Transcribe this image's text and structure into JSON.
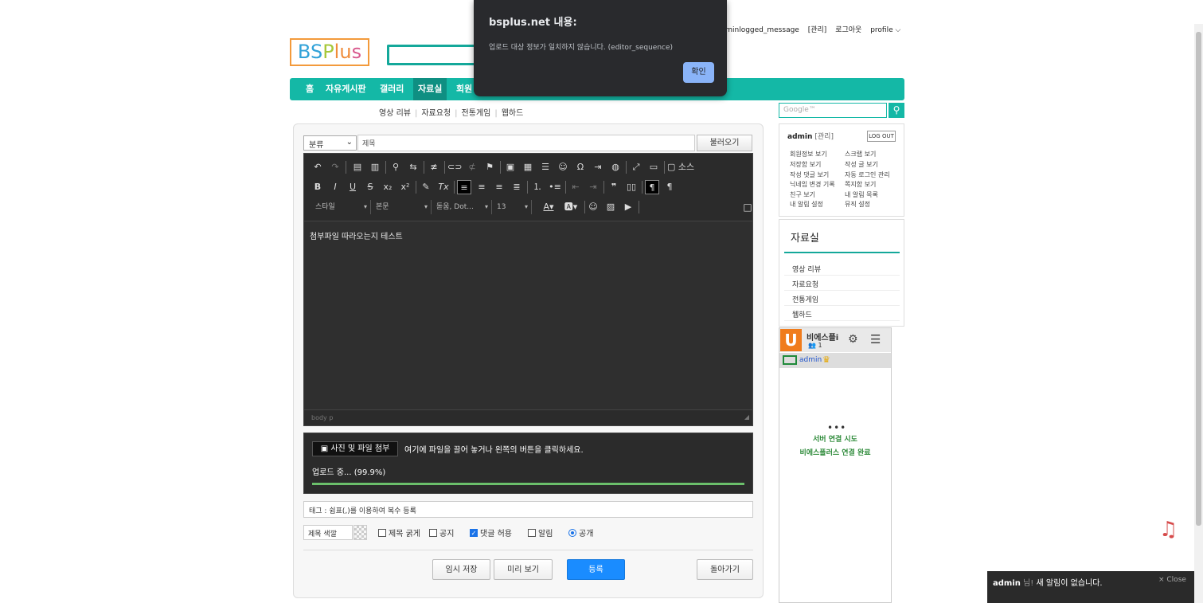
{
  "top_links": {
    "message": "adminlogged_message",
    "manage": "[관리]",
    "logout": "로그아웃",
    "profile": "profile ⌵"
  },
  "logo": {
    "part1": "BS",
    "part2": "P",
    "part3": "lu",
    "part4": "s"
  },
  "nav": {
    "items": [
      "홈",
      "자유게시판",
      "갤러리",
      "자료실",
      "회원"
    ]
  },
  "subnav": {
    "items": [
      "영상 리뷰",
      "자료요청",
      "전통게임",
      "웹하드"
    ]
  },
  "google_placeholder": "Google™",
  "editor_form": {
    "category": "분류",
    "title_placeholder": "제목",
    "load_button": "불러오기",
    "toolbar": {
      "source": "소스",
      "style": "스타일",
      "format": "본문",
      "font": "돋움, Dot...",
      "size": "13"
    },
    "content": "첨부파일 따라오는지 테스트",
    "path": "body  p"
  },
  "upload": {
    "button": "사진 및 파일 첨부",
    "hint": "여기에 파일을 끌어 놓거나 왼쪽의 버튼을 클릭하세요.",
    "status": "업로드 중... (99.9%)",
    "progress": 0.999
  },
  "tags_placeholder": "태그 : 쉼표(,)를 이용하여 복수 등록",
  "options": {
    "title_color": "제목 색깔",
    "bold_title": "제목 굵게",
    "notice": "공지",
    "allow_comments": "댓글 허용",
    "notify": "알림",
    "public": "공개"
  },
  "buttons": {
    "temp_save": "임시 저장",
    "preview": "미리 보기",
    "submit": "등록",
    "back": "돌아가기"
  },
  "login_box": {
    "user": "admin",
    "manage": "[관리]",
    "logout": "LOG OUT",
    "links_left": [
      "회원정보 보기",
      "저장함 보기",
      "작성 댓글 보기",
      "닉네임 변경 기록",
      "친구 보기",
      "내 알림 설정"
    ],
    "links_right": [
      "스크랩 보기",
      "작성 글 보기",
      "자동 로그인 관리",
      "쪽지함 보기",
      "내 알림 목록",
      "뮤직 설정"
    ]
  },
  "jaryo_box": {
    "title": "자료실",
    "items": [
      "영상 리뷰",
      "자료요청",
      "전통게임",
      "웹하드"
    ]
  },
  "chat": {
    "logo": "U",
    "name": "비에스플i",
    "count": "1",
    "user": "admin",
    "dots": "•••",
    "status1": "서버 연결 시도",
    "status2": "비에스플러스 연결 완료"
  },
  "notification": {
    "user": "admin",
    "suffix": "님!",
    "message": "새 알림이 없습니다.",
    "close": "× Close"
  },
  "dialog": {
    "title": "bsplus.net 내용:",
    "message": "업로드 대상 정보가 일치하지 않습니다. (editor_sequence)",
    "ok": "확인"
  },
  "colors": {
    "accent": "#14b8a6",
    "primary_button": "#1a8cff",
    "dialog_bg": "#292a2d",
    "dialog_button": "#8ab4f8"
  }
}
